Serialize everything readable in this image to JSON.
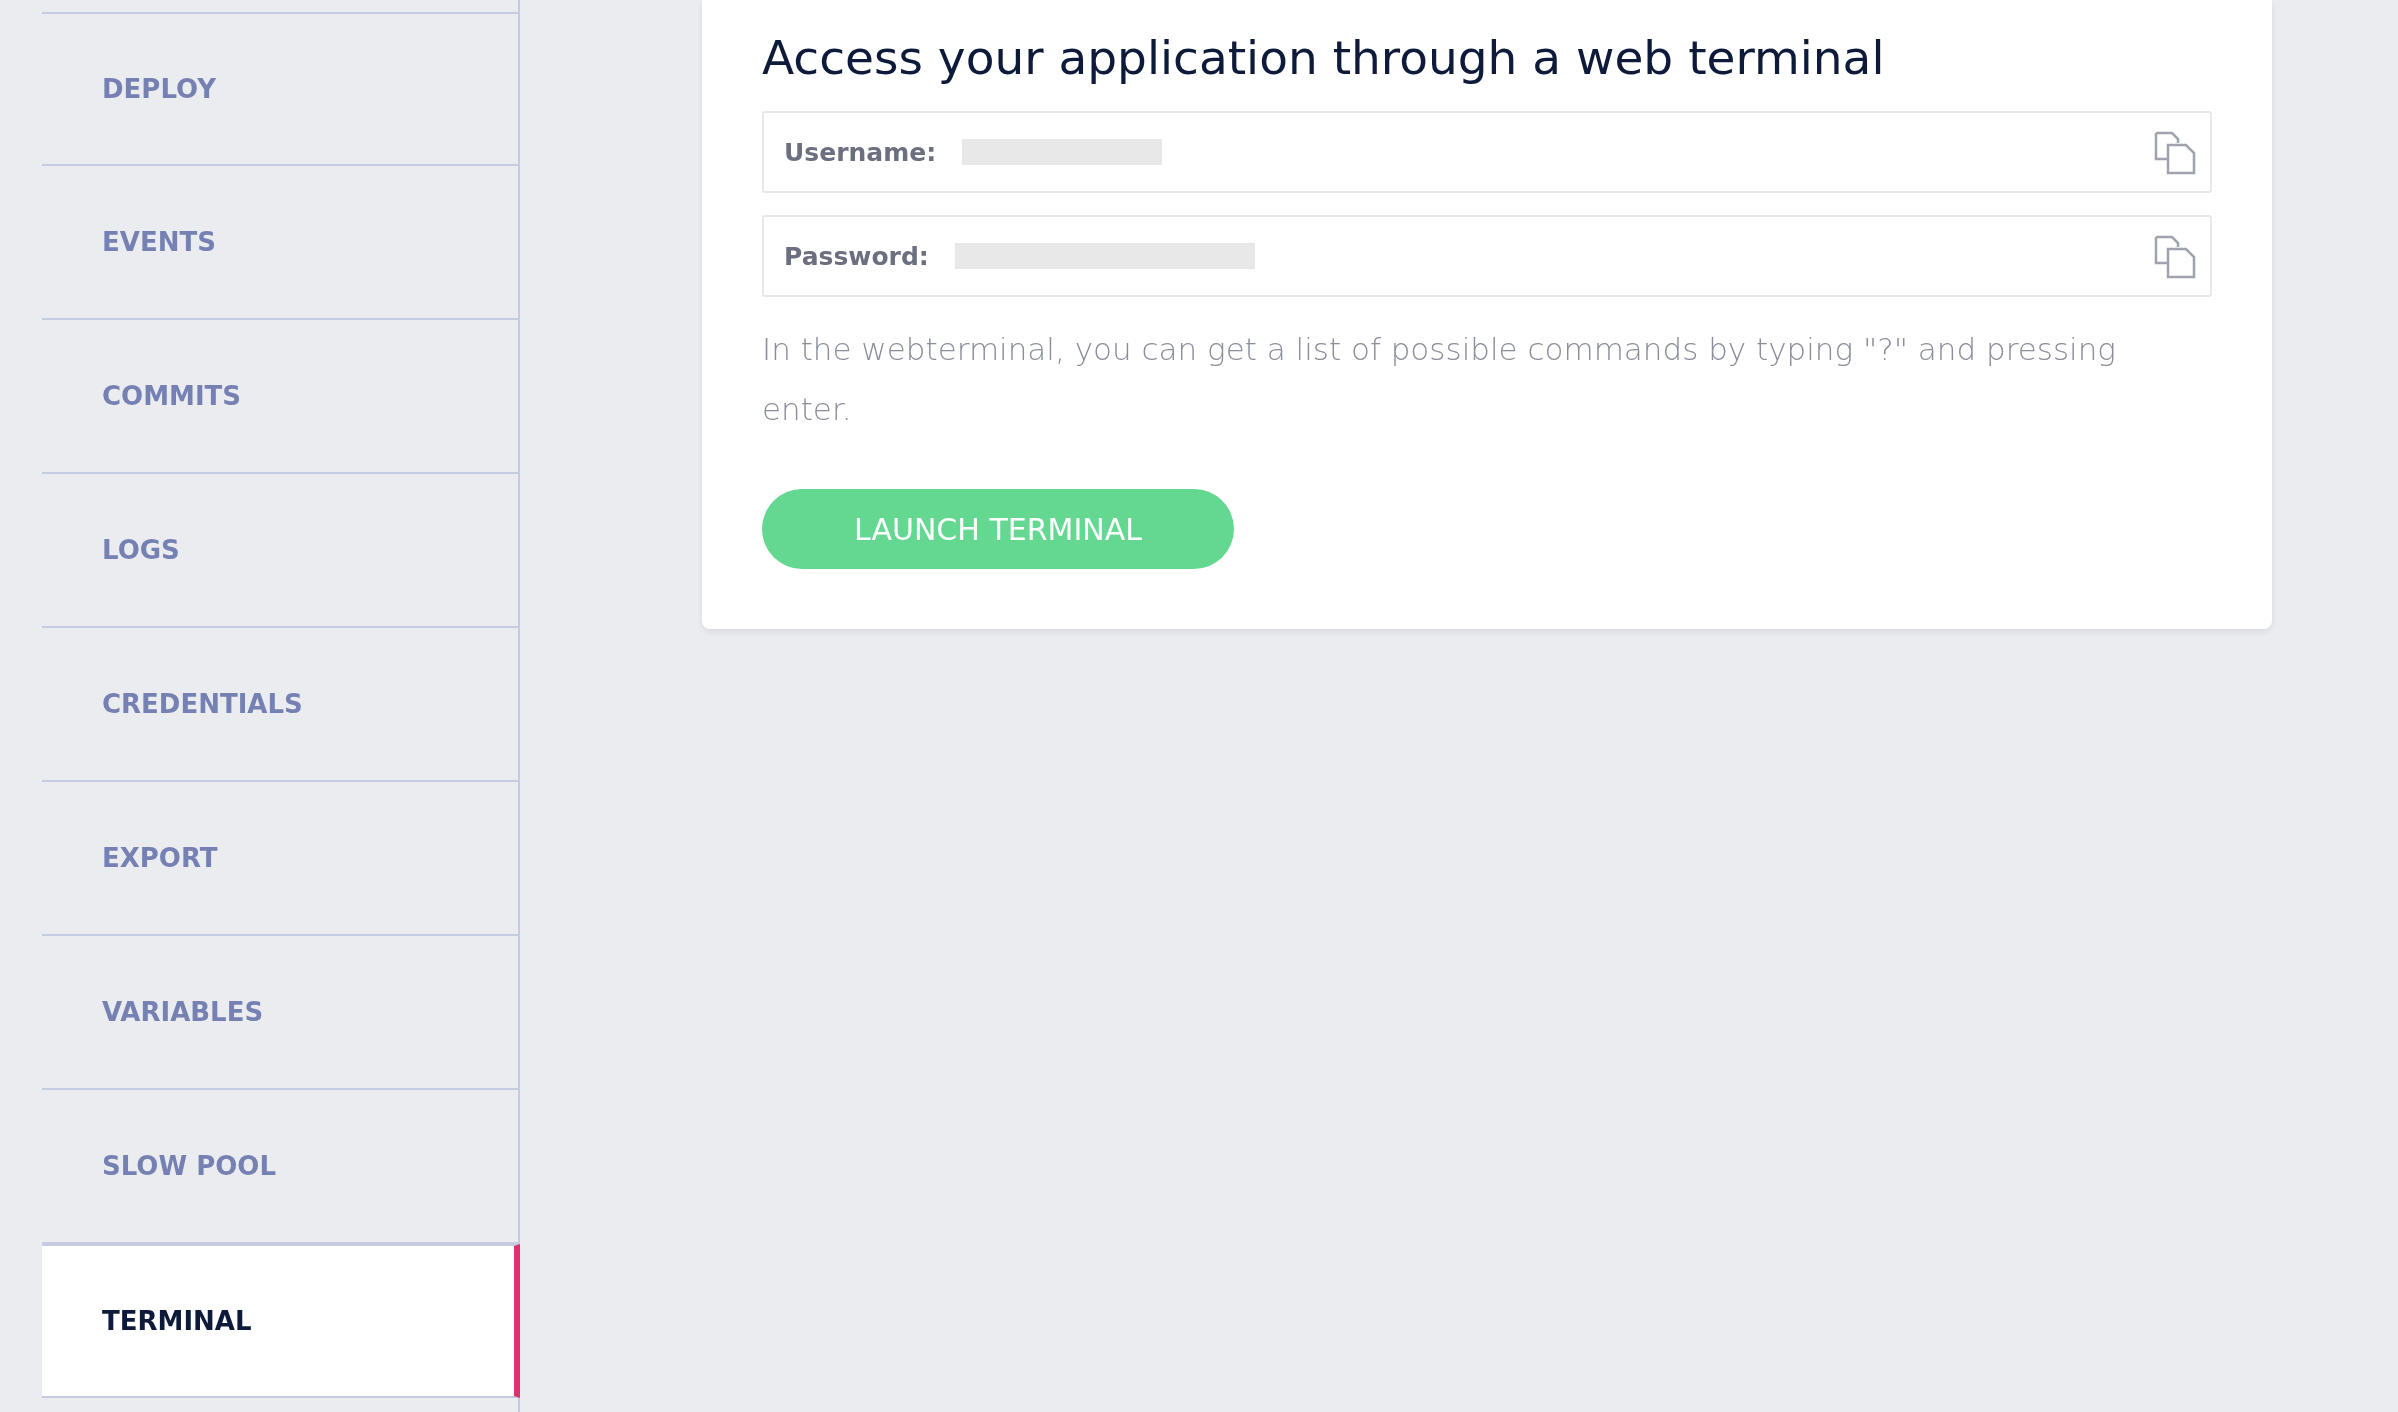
{
  "sidebar": {
    "items": [
      {
        "label": "DEPLOY",
        "selected": false
      },
      {
        "label": "EVENTS",
        "selected": false
      },
      {
        "label": "COMMITS",
        "selected": false
      },
      {
        "label": "LOGS",
        "selected": false
      },
      {
        "label": "CREDENTIALS",
        "selected": false
      },
      {
        "label": "EXPORT",
        "selected": false
      },
      {
        "label": "VARIABLES",
        "selected": false
      },
      {
        "label": "SLOW POOL",
        "selected": false
      },
      {
        "label": "TERMINAL",
        "selected": true
      }
    ]
  },
  "card": {
    "title": "Access your application through a web terminal",
    "fields": [
      {
        "label": "Username:"
      },
      {
        "label": "Password:"
      }
    ],
    "help": "In the webterminal, you can get a list of possible commands by typing \"?\" and pressing enter.",
    "button": "LAUNCH TERMINAL"
  }
}
